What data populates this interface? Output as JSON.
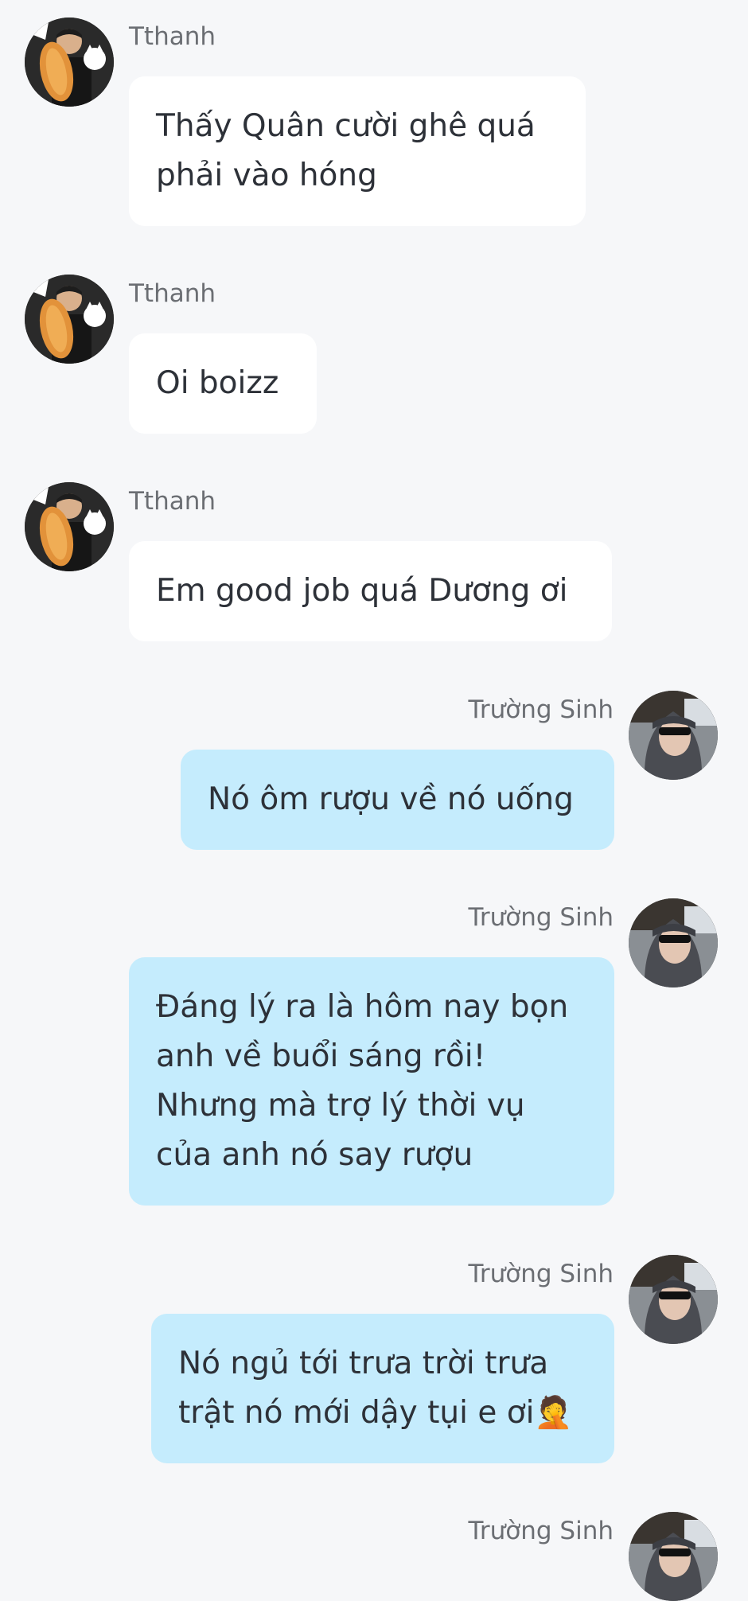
{
  "messages": [
    {
      "sender": "Tthanh",
      "avatar": "bread-holding-person-avatar",
      "lines": [
        "Thấy Quân cười ghê quá",
        "phải vào hóng"
      ]
    },
    {
      "sender": "Tthanh",
      "avatar": "bread-holding-person-avatar",
      "lines": [
        "Oi boizz"
      ]
    },
    {
      "sender": "Tthanh",
      "avatar": "bread-holding-person-avatar",
      "lines": [
        "Em good job quá Dương ơi"
      ]
    },
    {
      "sender": "Trường Sinh",
      "avatar": "hooded-person-sunglasses-avatar",
      "lines": [
        "Nó ôm rượu về nó uống"
      ]
    },
    {
      "sender": "Trường Sinh",
      "avatar": "hooded-person-sunglasses-avatar",
      "lines": [
        "Đáng lý ra là hôm nay bọn",
        "anh về buổi sáng rồi!",
        "Nhưng mà trợ lý thời vụ",
        "của anh nó say rượu"
      ]
    },
    {
      "sender": "Trường Sinh",
      "avatar": "hooded-person-sunglasses-avatar",
      "lines": [
        "Nó ngủ tới trưa trời trưa",
        "trật nó mới dậy tụi e ơi🤦"
      ]
    },
    {
      "sender": "Trường Sinh",
      "avatar": "hooded-person-sunglasses-avatar",
      "lines": []
    }
  ],
  "colors": {
    "background": "#f6f7f9",
    "incoming_bubble": "#ffffff",
    "outgoing_bubble": "#c5ecfd",
    "text": "#2d3138",
    "sender_text": "#6b6e73"
  }
}
